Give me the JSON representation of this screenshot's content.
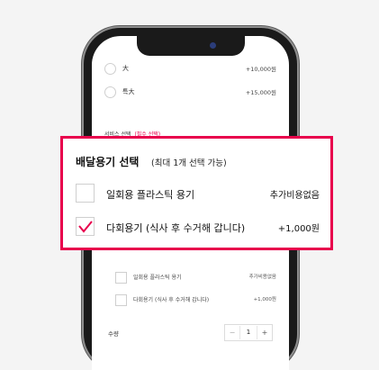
{
  "size_options": [
    {
      "label": "大",
      "price": "+10,000원"
    },
    {
      "label": "특大",
      "price": "+15,000원"
    }
  ],
  "service": {
    "title": "서비스 선택",
    "required_tag": "(필수 선택)"
  },
  "callout": {
    "title": "배달용기 선택",
    "subtitle": "(최대 1개 선택 가능)",
    "options": [
      {
        "label": "일회용 플라스틱 용기",
        "price": "추가비용없음",
        "checked": false
      },
      {
        "label": "다회용기 (식사 후 수거해 갑니다)",
        "price": "+1,000원",
        "checked": true
      }
    ]
  },
  "container_options": [
    {
      "label": "일회용 플라스틱 용기",
      "price": "추가비용없음"
    },
    {
      "label": "다회용기 (식사 후 수거해 갑니다)",
      "price": "+1,000원"
    }
  ],
  "quantity": {
    "label": "수량",
    "value": "1",
    "minus": "−",
    "plus": "+"
  },
  "colors": {
    "accent": "#e8004c",
    "camera": "#2b3d7a"
  }
}
